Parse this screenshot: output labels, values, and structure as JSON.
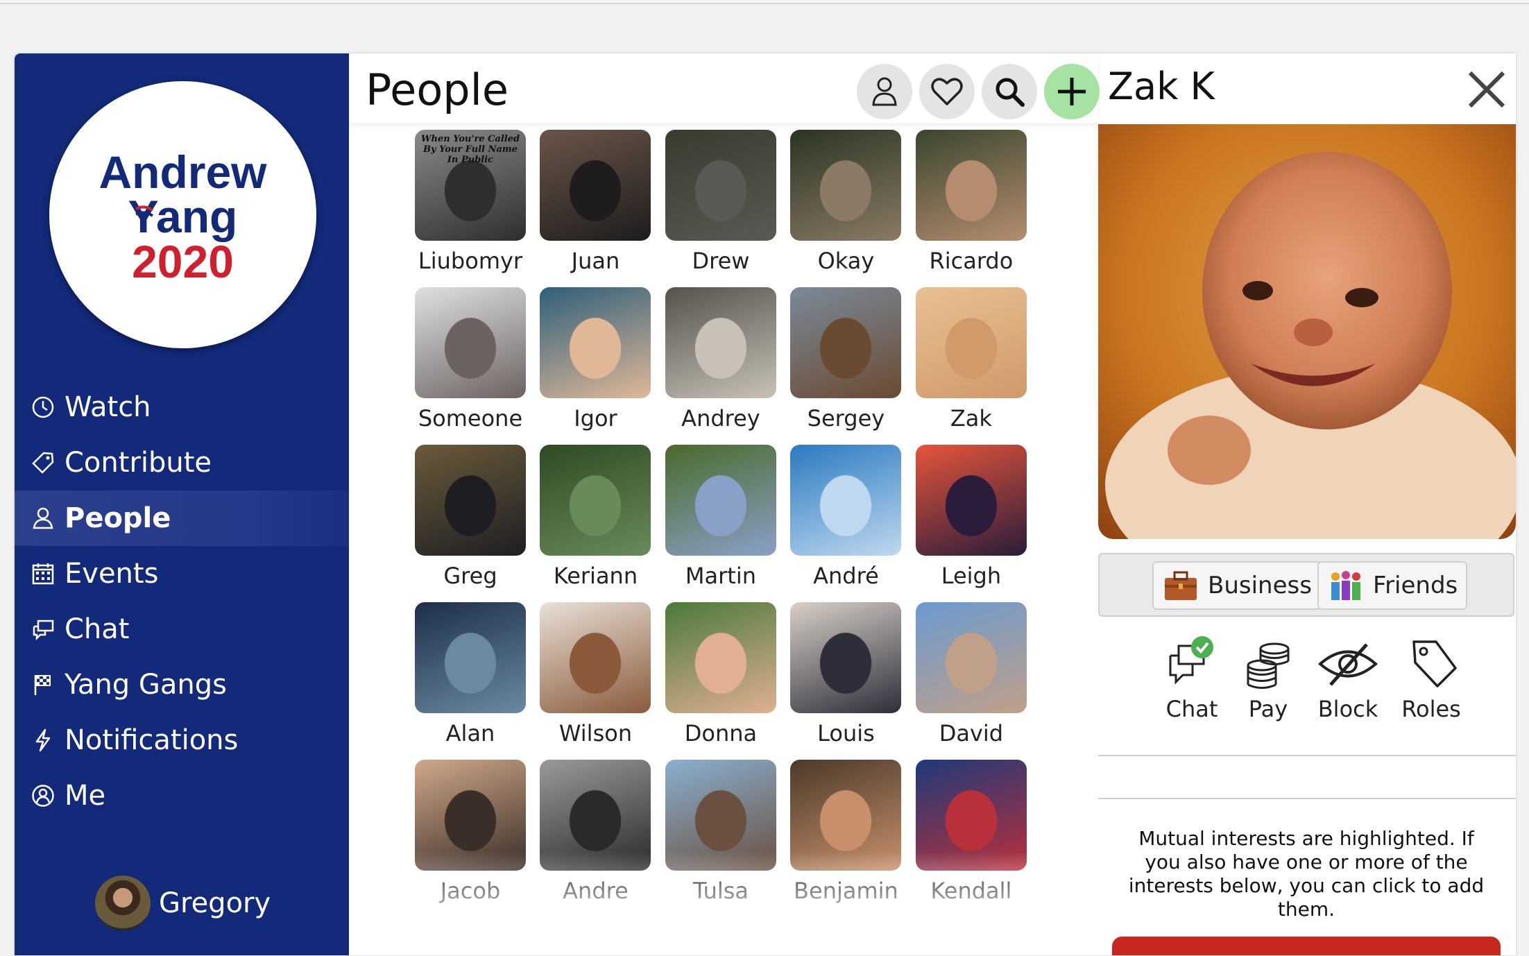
{
  "logo": {
    "line1": "Andrew",
    "line2": "Yang",
    "line3": "2020",
    "color_blue": "#13297a",
    "color_red": "#d0202e"
  },
  "sidebar": {
    "items": [
      {
        "label": "Watch",
        "icon": "clock-icon",
        "active": false
      },
      {
        "label": "Contribute",
        "icon": "tag-icon",
        "active": false
      },
      {
        "label": "People",
        "icon": "person-icon",
        "active": true
      },
      {
        "label": "Events",
        "icon": "calendar-icon",
        "active": false
      },
      {
        "label": "Chat",
        "icon": "chat-bubbles-icon",
        "active": false
      },
      {
        "label": "Yang Gangs",
        "icon": "checkered-flag-icon",
        "active": false
      },
      {
        "label": "Notifications",
        "icon": "lightning-icon",
        "active": false
      },
      {
        "label": "Me",
        "icon": "user-circle-icon",
        "active": false
      }
    ],
    "user": {
      "name": "Gregory"
    },
    "color": "#13297a"
  },
  "people_panel": {
    "title": "People",
    "header_buttons": [
      "person-icon",
      "heart-icon",
      "search-icon",
      "plus-icon"
    ],
    "people": [
      {
        "name": "Liubomyr",
        "photo_caption": "When You're Called By Your Full Name In Public"
      },
      {
        "name": "Juan"
      },
      {
        "name": "Drew"
      },
      {
        "name": "Okay"
      },
      {
        "name": "Ricardo"
      },
      {
        "name": "Someone"
      },
      {
        "name": "Igor"
      },
      {
        "name": "Andrey"
      },
      {
        "name": "Sergey"
      },
      {
        "name": "Zak"
      },
      {
        "name": "Greg"
      },
      {
        "name": "Keriann"
      },
      {
        "name": "Martin"
      },
      {
        "name": "André"
      },
      {
        "name": "Leigh"
      },
      {
        "name": "Alan"
      },
      {
        "name": "Wilson"
      },
      {
        "name": "Donna"
      },
      {
        "name": "Louis"
      },
      {
        "name": "David"
      },
      {
        "name": "Jacob"
      },
      {
        "name": "Andre"
      },
      {
        "name": "Tulsa"
      },
      {
        "name": "Benjamin"
      },
      {
        "name": "Kendall"
      }
    ]
  },
  "profile": {
    "name": "Zak K",
    "tags": [
      {
        "label": "Business",
        "icon": "briefcase-icon"
      },
      {
        "label": "Friends",
        "icon": "friends-icon"
      }
    ],
    "actions": [
      {
        "label": "Chat",
        "icon": "chat-icon"
      },
      {
        "label": "Pay",
        "icon": "coins-icon"
      },
      {
        "label": "Block",
        "icon": "eye-slash-icon"
      },
      {
        "label": "Roles",
        "icon": "tag-icon"
      }
    ],
    "mutual_text": "Mutual interests are highlighted. If you also have one or more of the interests below, you can click to add them.",
    "accent_green": "#4caf50",
    "accent_red": "#c8261f"
  }
}
